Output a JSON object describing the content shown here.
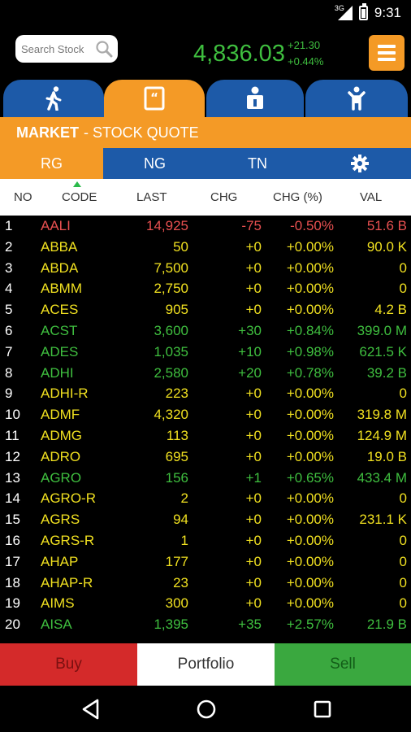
{
  "status": {
    "network": "3G",
    "time": "9:31"
  },
  "header": {
    "search_placeholder": "Search Stock",
    "index_value": "4,836.03",
    "index_change": "+21.30",
    "index_change_pct": "+0.44%"
  },
  "tabs": [
    {
      "icon": "walking-person-icon",
      "active": false
    },
    {
      "icon": "quote-document-icon",
      "active": true
    },
    {
      "icon": "person-id-icon",
      "active": false
    },
    {
      "icon": "person-standing-icon",
      "active": false
    }
  ],
  "market": {
    "section": "MARKET",
    "separator": " - ",
    "page": "STOCK QUOTE"
  },
  "subtabs": [
    {
      "label": "RG",
      "active": true
    },
    {
      "label": "NG",
      "active": false
    },
    {
      "label": "TN",
      "active": false
    }
  ],
  "columns": {
    "no": "NO",
    "code": "CODE",
    "last": "LAST",
    "chg": "CHG",
    "pct": "CHG (%)",
    "val": "VAL"
  },
  "rows": [
    {
      "no": "1",
      "code": "AALI",
      "last": "14,925",
      "chg": "-75",
      "pct": "-0.50%",
      "val": "51.6 B",
      "color": "red"
    },
    {
      "no": "2",
      "code": "ABBA",
      "last": "50",
      "chg": "+0",
      "pct": "+0.00%",
      "val": "90.0 K",
      "color": "yellow"
    },
    {
      "no": "3",
      "code": "ABDA",
      "last": "7,500",
      "chg": "+0",
      "pct": "+0.00%",
      "val": "0",
      "color": "yellow"
    },
    {
      "no": "4",
      "code": "ABMM",
      "last": "2,750",
      "chg": "+0",
      "pct": "+0.00%",
      "val": "0",
      "color": "yellow"
    },
    {
      "no": "5",
      "code": "ACES",
      "last": "905",
      "chg": "+0",
      "pct": "+0.00%",
      "val": "4.2 B",
      "color": "yellow"
    },
    {
      "no": "6",
      "code": "ACST",
      "last": "3,600",
      "chg": "+30",
      "pct": "+0.84%",
      "val": "399.0 M",
      "color": "green"
    },
    {
      "no": "7",
      "code": "ADES",
      "last": "1,035",
      "chg": "+10",
      "pct": "+0.98%",
      "val": "621.5 K",
      "color": "green"
    },
    {
      "no": "8",
      "code": "ADHI",
      "last": "2,580",
      "chg": "+20",
      "pct": "+0.78%",
      "val": "39.2 B",
      "color": "green"
    },
    {
      "no": "9",
      "code": "ADHI-R",
      "last": "223",
      "chg": "+0",
      "pct": "+0.00%",
      "val": "0",
      "color": "yellow"
    },
    {
      "no": "10",
      "code": "ADMF",
      "last": "4,320",
      "chg": "+0",
      "pct": "+0.00%",
      "val": "319.8 M",
      "color": "yellow"
    },
    {
      "no": "11",
      "code": "ADMG",
      "last": "113",
      "chg": "+0",
      "pct": "+0.00%",
      "val": "124.9 M",
      "color": "yellow"
    },
    {
      "no": "12",
      "code": "ADRO",
      "last": "695",
      "chg": "+0",
      "pct": "+0.00%",
      "val": "19.0 B",
      "color": "yellow"
    },
    {
      "no": "13",
      "code": "AGRO",
      "last": "156",
      "chg": "+1",
      "pct": "+0.65%",
      "val": "433.4 M",
      "color": "green"
    },
    {
      "no": "14",
      "code": "AGRO-R",
      "last": "2",
      "chg": "+0",
      "pct": "+0.00%",
      "val": "0",
      "color": "yellow"
    },
    {
      "no": "15",
      "code": "AGRS",
      "last": "94",
      "chg": "+0",
      "pct": "+0.00%",
      "val": "231.1 K",
      "color": "yellow"
    },
    {
      "no": "16",
      "code": "AGRS-R",
      "last": "1",
      "chg": "+0",
      "pct": "+0.00%",
      "val": "0",
      "color": "yellow"
    },
    {
      "no": "17",
      "code": "AHAP",
      "last": "177",
      "chg": "+0",
      "pct": "+0.00%",
      "val": "0",
      "color": "yellow"
    },
    {
      "no": "18",
      "code": "AHAP-R",
      "last": "23",
      "chg": "+0",
      "pct": "+0.00%",
      "val": "0",
      "color": "yellow"
    },
    {
      "no": "19",
      "code": "AIMS",
      "last": "300",
      "chg": "+0",
      "pct": "+0.00%",
      "val": "0",
      "color": "yellow"
    },
    {
      "no": "20",
      "code": "AISA",
      "last": "1,395",
      "chg": "+35",
      "pct": "+2.57%",
      "val": "21.9 B",
      "color": "green"
    }
  ],
  "actions": {
    "buy": "Buy",
    "portfolio": "Portfolio",
    "sell": "Sell"
  },
  "colors": {
    "accent": "#f49a26",
    "tab_blue": "#1d5aa8",
    "up": "#3fbf3f",
    "down": "#e85050",
    "flat": "#f0e020"
  }
}
